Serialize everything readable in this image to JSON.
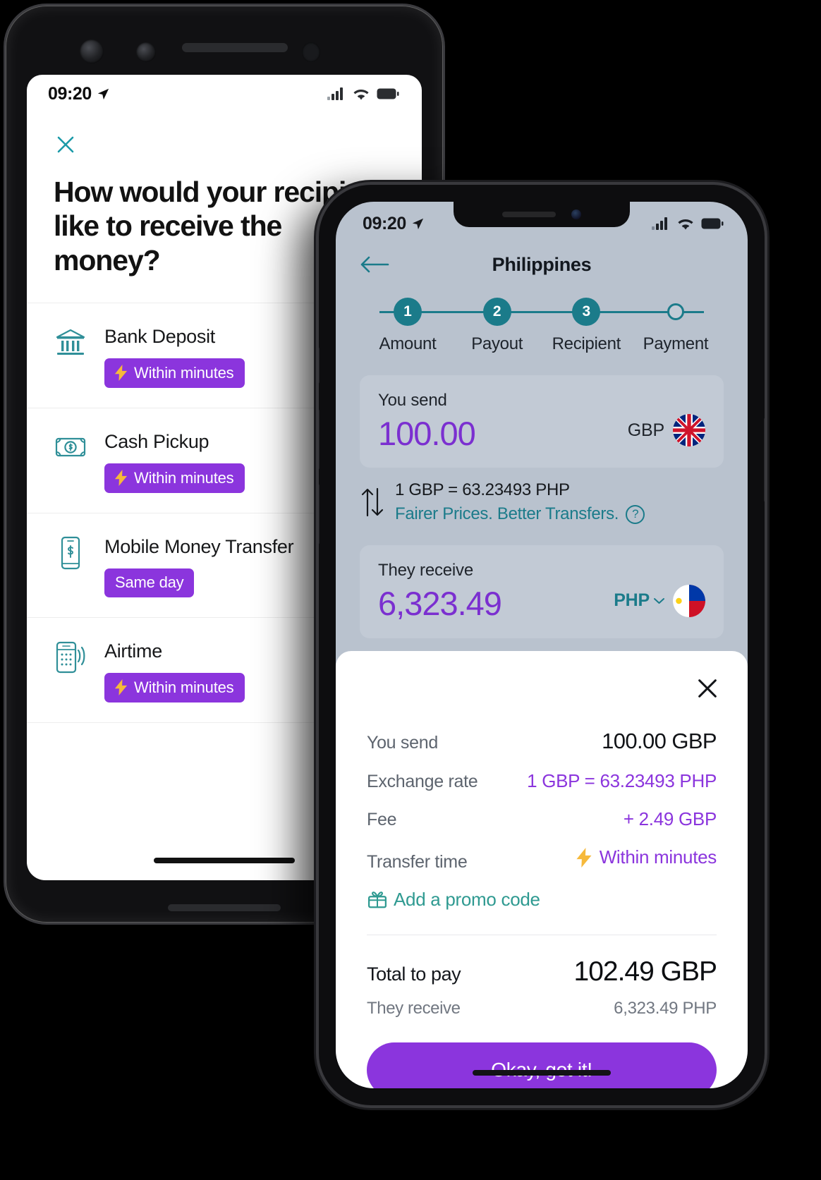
{
  "left_phone": {
    "status": {
      "time": "09:20",
      "location_icon": "location-arrow-icon",
      "signal": "cellular-bars-icon",
      "wifi": "wifi-icon",
      "battery": "battery-full-icon"
    },
    "close_label": "close-icon",
    "title": "How would your recipient like to receive the money?",
    "options": [
      {
        "icon": "bank-icon",
        "label": "Bank Deposit",
        "badge": "Within minutes",
        "badge_icon": "lightning-bolt-icon"
      },
      {
        "icon": "cash-icon",
        "label": "Cash Pickup",
        "badge": "Within minutes",
        "badge_icon": "lightning-bolt-icon"
      },
      {
        "icon": "mobile-money-icon",
        "label": "Mobile Money Transfer",
        "badge": "Same day",
        "badge_icon": ""
      },
      {
        "icon": "airtime-icon",
        "label": "Airtime",
        "badge": "Within minutes",
        "badge_icon": "lightning-bolt-icon"
      }
    ]
  },
  "right_phone": {
    "status": {
      "time": "09:20",
      "location_icon": "location-arrow-icon",
      "signal": "cellular-bars-icon",
      "wifi": "wifi-icon",
      "battery": "battery-full-icon"
    },
    "header": {
      "back_icon": "arrow-left-icon",
      "country": "Philippines"
    },
    "stepper": [
      {
        "num": "1",
        "label": "Amount",
        "state": "done"
      },
      {
        "num": "2",
        "label": "Payout",
        "state": "done"
      },
      {
        "num": "3",
        "label": "Recipient",
        "state": "done"
      },
      {
        "num": "",
        "label": "Payment",
        "state": "pending"
      }
    ],
    "send_card": {
      "label": "You send",
      "value": "100.00",
      "currency": "GBP",
      "flag": "uk-flag-icon"
    },
    "rate": {
      "line1": "1 GBP = 63.23493 PHP",
      "line2": "Fairer Prices. Better Transfers.",
      "help_icon": "question-mark-icon",
      "swap_icon": "swap-arrows-icon"
    },
    "receive_card": {
      "label": "They receive",
      "value": "6,323.49",
      "currency": "PHP",
      "chevron": "chevron-down-icon",
      "flag": "philippines-flag-icon"
    },
    "sheet": {
      "close_icon": "close-icon",
      "rows": [
        {
          "key": "You send",
          "value": "100.00 GBP",
          "style": "plain"
        },
        {
          "key": "Exchange rate",
          "value": "1 GBP = 63.23493 PHP",
          "style": "accent"
        },
        {
          "key": "Fee",
          "value": "+ 2.49 GBP",
          "style": "accent"
        },
        {
          "key": "Transfer time",
          "value": "Within minutes",
          "style": "accent-bolt"
        }
      ],
      "promo": {
        "icon": "gift-icon",
        "label": "Add a promo code"
      },
      "total": {
        "key": "Total to pay",
        "value": "102.49 GBP"
      },
      "receive": {
        "key": "They receive",
        "value": "6,323.49 PHP"
      },
      "cta": "Okay, got it!"
    }
  },
  "colors": {
    "purple": "#8b35dd",
    "purple_value": "#7b2fd0",
    "teal": "#1b7b8a",
    "teal_promo": "#2f9a91",
    "screen_bg": "#b9c2ce",
    "card_bg": "#c2cad5",
    "bolt": "#f6b93b"
  }
}
